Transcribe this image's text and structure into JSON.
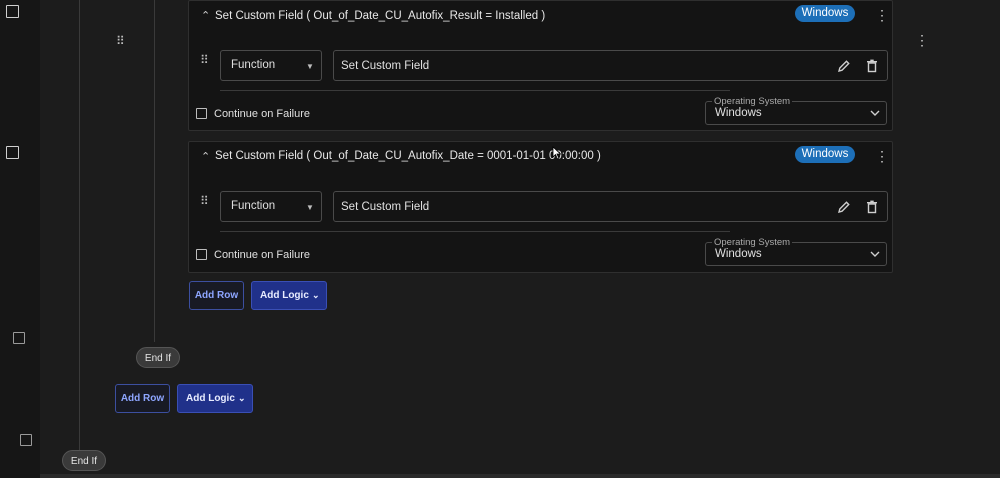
{
  "rows": [
    {
      "title": "Set Custom Field ( Out_of_Date_CU_Autofix_Result = Installed )",
      "badge": "Windows",
      "type_select": "Function",
      "action_value": "Set Custom Field",
      "continue_on_failure": "Continue on Failure",
      "os_label": "Operating System",
      "os_value": "Windows"
    },
    {
      "title": "Set Custom Field ( Out_of_Date_CU_Autofix_Date = 0001-01-01 00:00:00 )",
      "badge": "Windows",
      "type_select": "Function",
      "action_value": "Set Custom Field",
      "continue_on_failure": "Continue on Failure",
      "os_label": "Operating System",
      "os_value": "Windows"
    }
  ],
  "inner_actions": {
    "add_row": "Add Row",
    "add_logic": "Add Logic",
    "end_if": "End If"
  },
  "outer_actions": {
    "add_row": "Add Row",
    "add_logic": "Add Logic",
    "end_if": "End If"
  },
  "icons": {
    "grip": "drag-handle-icon",
    "kebab": "more-options-icon",
    "edit": "pencil-icon",
    "delete": "trash-icon",
    "collapse": "chevron-up-icon",
    "dropdown": "chevron-down-icon"
  }
}
